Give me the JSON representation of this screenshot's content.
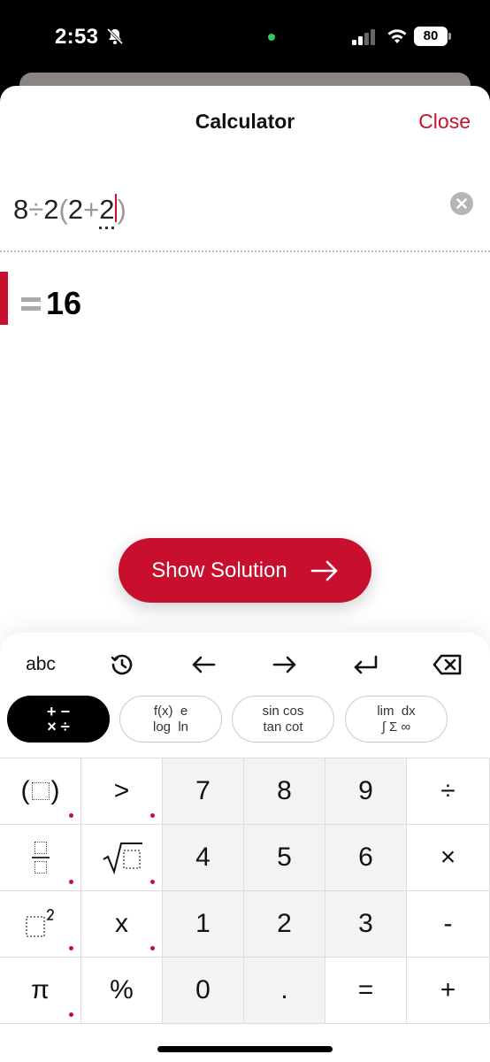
{
  "status_bar": {
    "time": "2:53",
    "battery": "80"
  },
  "header": {
    "title": "Calculator",
    "close_label": "Close"
  },
  "expression": {
    "t1": "8",
    "t2": "÷",
    "t3": "2",
    "t4": "(",
    "t5": "2",
    "t6": "+",
    "t7": "2",
    "t8": ")"
  },
  "result": {
    "value": "16"
  },
  "show_solution": {
    "label": "Show Solution"
  },
  "keyboard": {
    "top_row": {
      "abc": "abc"
    },
    "modes": [
      {
        "line1": "+ −",
        "line2": "× ÷"
      },
      {
        "line1": "f(x)  e",
        "line2": "log  ln"
      },
      {
        "line1": "sin cos",
        "line2": "tan cot"
      },
      {
        "line1": "lim  dx",
        "line2": "∫ Σ ∞"
      }
    ],
    "keys": {
      "gt": ">",
      "seven": "7",
      "eight": "8",
      "nine": "9",
      "divide": "÷",
      "four": "4",
      "five": "5",
      "six": "6",
      "times": "×",
      "x": "x",
      "one": "1",
      "two": "2",
      "three": "3",
      "minus": "-",
      "pi": "π",
      "percent": "%",
      "zero": "0",
      "dot": ".",
      "equals": "=",
      "plus": "+"
    }
  },
  "colors": {
    "accent": "#c8102e",
    "num_key_bg": "#f3f3f3"
  }
}
